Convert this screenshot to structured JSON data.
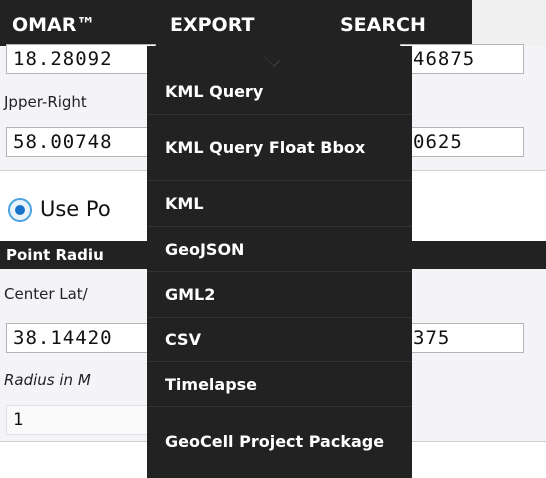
{
  "nav": {
    "brand": "OMAR™",
    "export": "EXPORT",
    "search": "SEARCH"
  },
  "bbox": {
    "lower_left_lat": "18.28092",
    "lower_left_lon": "46875",
    "upper_right_label": "Jpper-Right",
    "upper_right_lat": "58.00748",
    "upper_right_lon": "0625"
  },
  "radio_use_point": "Use Po",
  "point_radius": {
    "header": "Point Radiu",
    "center_label": "Center Lat/",
    "center_lat": "38.14420",
    "center_lon": "375",
    "radius_label": "Radius in M",
    "radius_value": "1"
  },
  "export_menu": {
    "items": [
      "KML Query",
      "KML Query Float Bbox",
      "KML",
      "GeoJSON",
      "GML2",
      "CSV",
      "Timelapse",
      "GeoCell Project Package"
    ]
  },
  "colors": {
    "navbar": "#222222",
    "menu": "#222222",
    "panel": "#f4f4f8",
    "radio_accent": "#1a73c9"
  }
}
